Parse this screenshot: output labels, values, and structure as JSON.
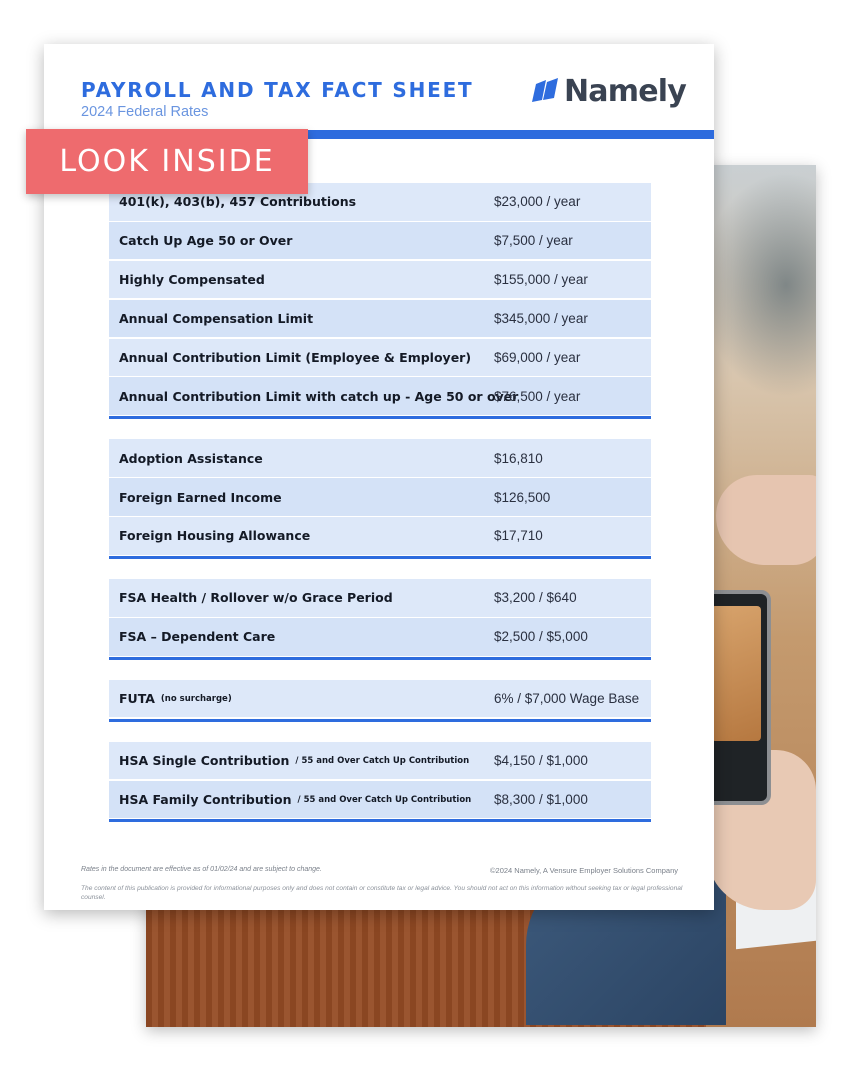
{
  "header": {
    "title": "PAYROLL AND TAX FACT SHEET",
    "subtitle": "2024 Federal Rates",
    "logo_text": "Namely"
  },
  "badge": {
    "label": "LOOK INSIDE"
  },
  "groups": [
    {
      "rows": [
        {
          "label": "401(k), 403(b), 457 Contributions",
          "value": "$23,000 / year"
        },
        {
          "label": "Catch Up Age 50 or Over",
          "value": "$7,500 / year"
        },
        {
          "label": "Highly Compensated",
          "value": "$155,000 / year"
        },
        {
          "label": "Annual Compensation Limit",
          "value": "$345,000 / year"
        },
        {
          "label": "Annual Contribution Limit (Employee & Employer)",
          "value": "$69,000 / year"
        },
        {
          "label": "Annual Contribution Limit with catch up - Age 50 or over",
          "value": "$76,500 / year"
        }
      ]
    },
    {
      "rows": [
        {
          "label": "Adoption Assistance",
          "value": "$16,810"
        },
        {
          "label": "Foreign Earned Income",
          "value": "$126,500"
        },
        {
          "label": "Foreign Housing Allowance",
          "value": "$17,710"
        }
      ]
    },
    {
      "rows": [
        {
          "label": "FSA Health / Rollover w/o Grace Period",
          "value": "$3,200 / $640"
        },
        {
          "label": "FSA – Dependent Care",
          "value": "$2,500 / $5,000"
        }
      ]
    },
    {
      "rows": [
        {
          "label": "FUTA",
          "note": "(no surcharge)",
          "value": "6% / $7,000 Wage Base"
        }
      ]
    },
    {
      "rows": [
        {
          "label": "HSA Single Contribution",
          "note": "/ 55 and Over Catch Up Contribution",
          "value": "$4,150 / $1,000"
        },
        {
          "label": "HSA Family Contribution",
          "note": "/ 55 and Over Catch Up Contribution",
          "value": "$8,300 / $1,000"
        }
      ]
    }
  ],
  "footer": {
    "left": "Rates in the document are effective as of 01/02/24 and are subject to change.",
    "right": "©2024 Namely, A Vensure Employer Solutions Company",
    "disclaimer": "The content of this publication is provided for informational purposes only and does not contain or constitute tax or legal advice. You should not act on this information without seeking tax or legal professional counsel."
  },
  "colors": {
    "brand_blue": "#2e6cde",
    "badge_red": "#ee6b6e",
    "row_bg": "#dde8f9"
  }
}
